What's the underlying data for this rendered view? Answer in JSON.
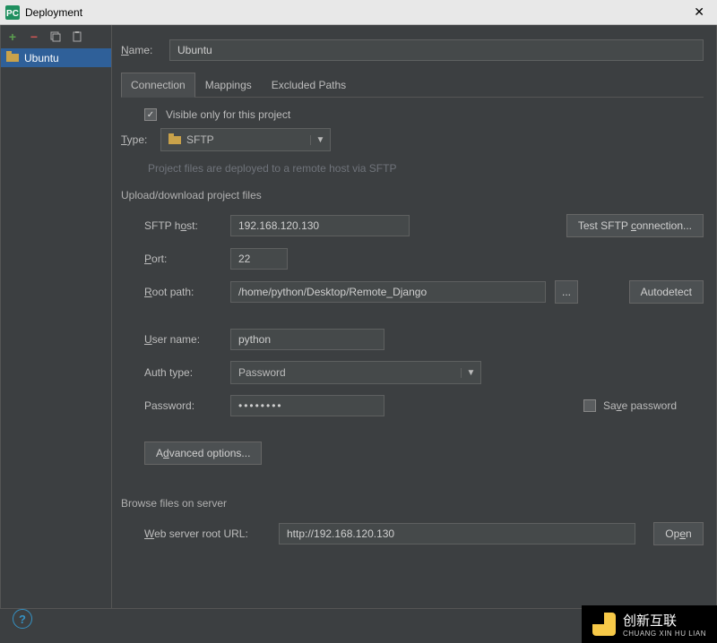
{
  "titlebar": {
    "title": "Deployment"
  },
  "sidebar": {
    "server_name": "Ubuntu"
  },
  "main": {
    "name_label": "Name:",
    "name_value": "Ubuntu",
    "tabs": {
      "connection": "Connection",
      "mappings": "Mappings",
      "excluded": "Excluded Paths"
    },
    "visible_only_label": "Visible only for this project",
    "type_label": "Type:",
    "type_value": "SFTP",
    "type_help": "Project files are deployed to a remote host via SFTP",
    "section1": "Upload/download project files",
    "host_label": "SFTP host:",
    "host_value": "192.168.120.130",
    "test_btn": "Test SFTP connection...",
    "port_label": "Port:",
    "port_value": "22",
    "root_label": "Root path:",
    "root_value": "/home/python/Desktop/Remote_Django",
    "root_browse": "...",
    "autodetect_btn": "Autodetect",
    "user_label": "User name:",
    "user_value": "python",
    "auth_label": "Auth type:",
    "auth_value": "Password",
    "pwd_label": "Password:",
    "pwd_value": "••••••••",
    "save_pw_label": "Save password",
    "adv_btn": "Advanced options...",
    "section2": "Browse files on server",
    "url_label": "Web server root URL:",
    "url_value": "http://192.168.120.130",
    "open_btn": "Open"
  },
  "watermark": {
    "cn": "创新互联",
    "en": "CHUANG XIN HU LIAN"
  }
}
